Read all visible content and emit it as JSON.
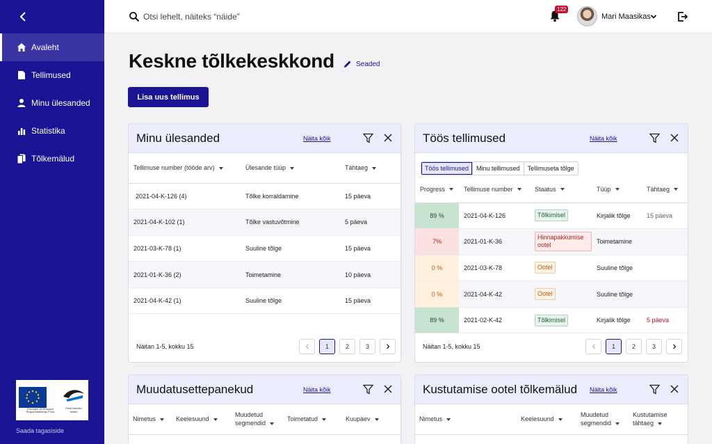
{
  "sidebar": {
    "items": [
      {
        "label": "Avaleht",
        "icon": "home-icon",
        "active": true
      },
      {
        "label": "Tellimused",
        "icon": "document-icon"
      },
      {
        "label": "Minu ülesanded",
        "icon": "user-icon"
      },
      {
        "label": "Statistika",
        "icon": "bar-chart-icon"
      },
      {
        "label": "Tõlkemälud",
        "icon": "files-icon"
      }
    ],
    "feedback": "Saada tagasiside",
    "eu_logo_caption": "Euroopa Liit Euroopa Regionaalarengu Fond",
    "estonia_logo_caption": "Eesti tuleviku heaks"
  },
  "topbar": {
    "search_placeholder": "Otsi lehelt, näiteks “näide”",
    "notifications": "122",
    "user_name": "Mari Maasikas"
  },
  "page": {
    "title": "Keskne tõlkekeskkond",
    "settings": "Seaded",
    "add_order": "Lisa uus tellimus"
  },
  "show_all": "Näita kõik",
  "tasks": {
    "title": "Minu ülesanded",
    "columns": [
      "Tellimuse number (tööde arv)",
      "Ülesande tüüp",
      "Tähtaeg"
    ],
    "rows": [
      [
        "2021-04-K-126 (4)",
        "Tõlke korraldamine",
        "15 päeva"
      ],
      [
        "2021-04-K-102 (1)",
        "Tõlke vastuvõtmine",
        "5 päeva"
      ],
      [
        "2021-03-K-78 (1)",
        "Suuline tõlge",
        "15 päeva"
      ],
      [
        "2021-01-K-36 (2)",
        "Toimetamine",
        "10 päeva"
      ],
      [
        "2021-04-K-42 (1)",
        "Suuline tõlge",
        "15 päeva"
      ]
    ],
    "pager_info": "Näitan 1-5, kokku 15",
    "pages": [
      "1",
      "2",
      "3"
    ]
  },
  "orders": {
    "title": "Töös tellimused",
    "tabs": [
      "Töös tellimused",
      "Minu tellimused",
      "Tellimuseta tõlge"
    ],
    "columns": [
      "Progress",
      "Tellimuse number",
      "Staatus",
      "Tüüp",
      "Tähtaeg"
    ],
    "rows": [
      {
        "progress": "89 %",
        "progress_value": 89,
        "number": "2021-04-K-126",
        "status": "Tõlkimisel",
        "status_kind": "green",
        "type": "Kirjalik tõlge",
        "deadline": "15 päeva",
        "deadline_color": "#666666"
      },
      {
        "progress": "7%",
        "progress_value": 7,
        "number": "2021-01-K-36",
        "status": "Hinnapakkumise ootel",
        "status_kind": "red",
        "type": "Toimetamine",
        "deadline": "",
        "deadline_color": "#666666"
      },
      {
        "progress": "0 %",
        "progress_value": 0,
        "number": "2021-03-K-78",
        "status": "Ootel",
        "status_kind": "orange",
        "type": "Suuline tõlge",
        "deadline": "",
        "deadline_color": "#666666"
      },
      {
        "progress": "0 %",
        "progress_value": 0,
        "number": "2021-04-K-42",
        "status": "Ootel",
        "status_kind": "orange",
        "type": "Suuline tõlge",
        "deadline": "",
        "deadline_color": "#666666"
      },
      {
        "progress": "89 %",
        "progress_value": 89,
        "number": "2021-02-K-42",
        "status": "Tõlkimisel",
        "status_kind": "green",
        "type": "Kirjalik tõlge",
        "deadline": "5 päeva",
        "deadline_color": "#c8102e"
      }
    ],
    "pager_info": "Näitan 1-5, kokku 15",
    "pages": [
      "1",
      "2",
      "3"
    ]
  },
  "changes": {
    "title": "Muudatusettepanekud",
    "columns": [
      "Nimetus",
      "Keelesuund",
      "Muudetud segmendid",
      "Toimetatud",
      "Kuupäev"
    ]
  },
  "deletions": {
    "title": "Kustutamise ootel tõlkemälud",
    "columns": [
      "Nimetus",
      "Keelesuund",
      "Muudetud segmendid",
      "Kustutamise tähtaeg"
    ]
  },
  "colors": {
    "brand": "#1a1494",
    "header_bg": "#ecedfc"
  }
}
